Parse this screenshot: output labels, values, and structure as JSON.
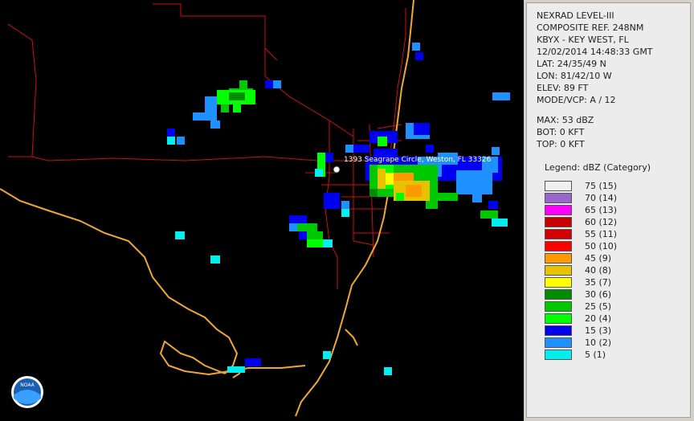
{
  "map": {
    "location_label": "1393 Seagrape Circle, Weston, FL 33326",
    "logo_text": "NOAA"
  },
  "info": {
    "lines": [
      "NEXRAD LEVEL-III",
      "COMPOSITE REF. 248NM",
      "KBYX - KEY WEST, FL",
      "12/02/2014 14:48:33 GMT",
      "LAT: 24/35/49 N",
      "LON: 81/42/10 W",
      "ELEV: 89 FT",
      "MODE/VCP: A / 12"
    ],
    "stats": [
      "MAX: 53 dBZ",
      "BOT: 0 KFT",
      "TOP: 0 KFT"
    ]
  },
  "legend": {
    "title": "Legend: dBZ (Category)",
    "items": [
      {
        "label": "75  (15)",
        "color": "#f0f0f0"
      },
      {
        "label": "70  (14)",
        "color": "#9966cc"
      },
      {
        "label": "65  (13)",
        "color": "#ff00ff"
      },
      {
        "label": "60  (12)",
        "color": "#c80000"
      },
      {
        "label": "55  (11)",
        "color": "#d40000"
      },
      {
        "label": "50  (10)",
        "color": "#ff0000"
      },
      {
        "label": "45  (9)",
        "color": "#ff9900"
      },
      {
        "label": "40  (8)",
        "color": "#e6c200"
      },
      {
        "label": "35  (7)",
        "color": "#ffff00"
      },
      {
        "label": "30  (6)",
        "color": "#008c00"
      },
      {
        "label": "25  (5)",
        "color": "#00c800"
      },
      {
        "label": "20  (4)",
        "color": "#00ff00"
      },
      {
        "label": "15  (3)",
        "color": "#0000f0"
      },
      {
        "label": "10  (2)",
        "color": "#1e90ff"
      },
      {
        "label": "5  (1)",
        "color": "#00eeee"
      }
    ]
  },
  "colors": {
    "coast": "#f0a830",
    "roads": "#cc1111",
    "background": "#000000"
  }
}
